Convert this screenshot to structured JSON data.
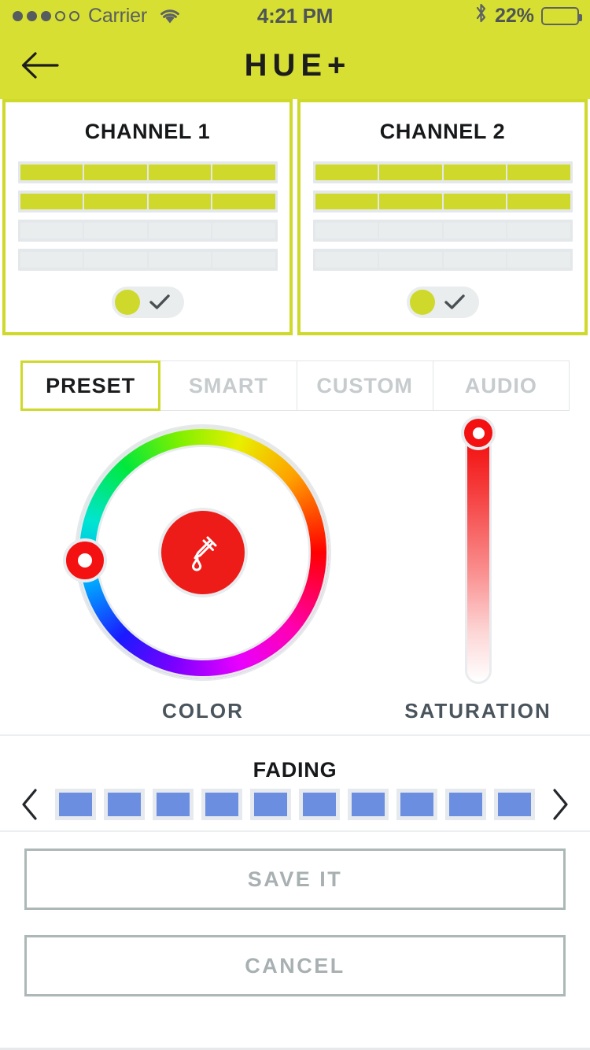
{
  "status_bar": {
    "signal_dots_filled": 3,
    "signal_dots_total": 5,
    "carrier": "Carrier",
    "wifi_icon": "wifi-icon",
    "time": "4:21 PM",
    "bluetooth_icon": "bluetooth-icon",
    "battery_percent": "22%",
    "battery_level": 22
  },
  "nav": {
    "back_icon": "arrow-left-icon",
    "title": "HUE+"
  },
  "theme": {
    "brand_yellow": "#d7e032",
    "brand_yellow_border": "#cfd92b",
    "accent_red": "#ee1c18",
    "fade_blue": "#6b8ee0",
    "muted_gray": "#a8b0b2"
  },
  "channels": [
    {
      "title": "CHANNEL 1",
      "rows": [
        [
          "on",
          "on",
          "on",
          "on"
        ],
        [
          "on",
          "on",
          "on",
          "on"
        ],
        [
          "off",
          "off",
          "off",
          "off"
        ],
        [
          "off",
          "off",
          "off",
          "off"
        ]
      ],
      "toggle": {
        "state": "on",
        "check_icon": "check-icon"
      }
    },
    {
      "title": "CHANNEL 2",
      "rows": [
        [
          "on",
          "on",
          "on",
          "on"
        ],
        [
          "on",
          "on",
          "on",
          "on"
        ],
        [
          "off",
          "off",
          "off",
          "off"
        ],
        [
          "off",
          "off",
          "off",
          "off"
        ]
      ],
      "toggle": {
        "state": "on",
        "check_icon": "check-icon"
      }
    }
  ],
  "tabs": [
    {
      "label": "PRESET",
      "active": true
    },
    {
      "label": "SMART",
      "active": false
    },
    {
      "label": "CUSTOM",
      "active": false
    },
    {
      "label": "AUDIO",
      "active": false
    }
  ],
  "picker": {
    "color_label": "COLOR",
    "saturation_label": "SATURATION",
    "selected_color": "#ee1c18",
    "eyedropper_icon": "eyedropper-icon",
    "hue_handle_position": "left",
    "saturation_handle_position": "top"
  },
  "fading": {
    "title": "FADING",
    "prev_icon": "chevron-left-icon",
    "next_icon": "chevron-right-icon",
    "swatch_color": "#6b8ee0",
    "swatch_count": 10
  },
  "actions": {
    "save_label": "SAVE IT",
    "cancel_label": "CANCEL"
  }
}
